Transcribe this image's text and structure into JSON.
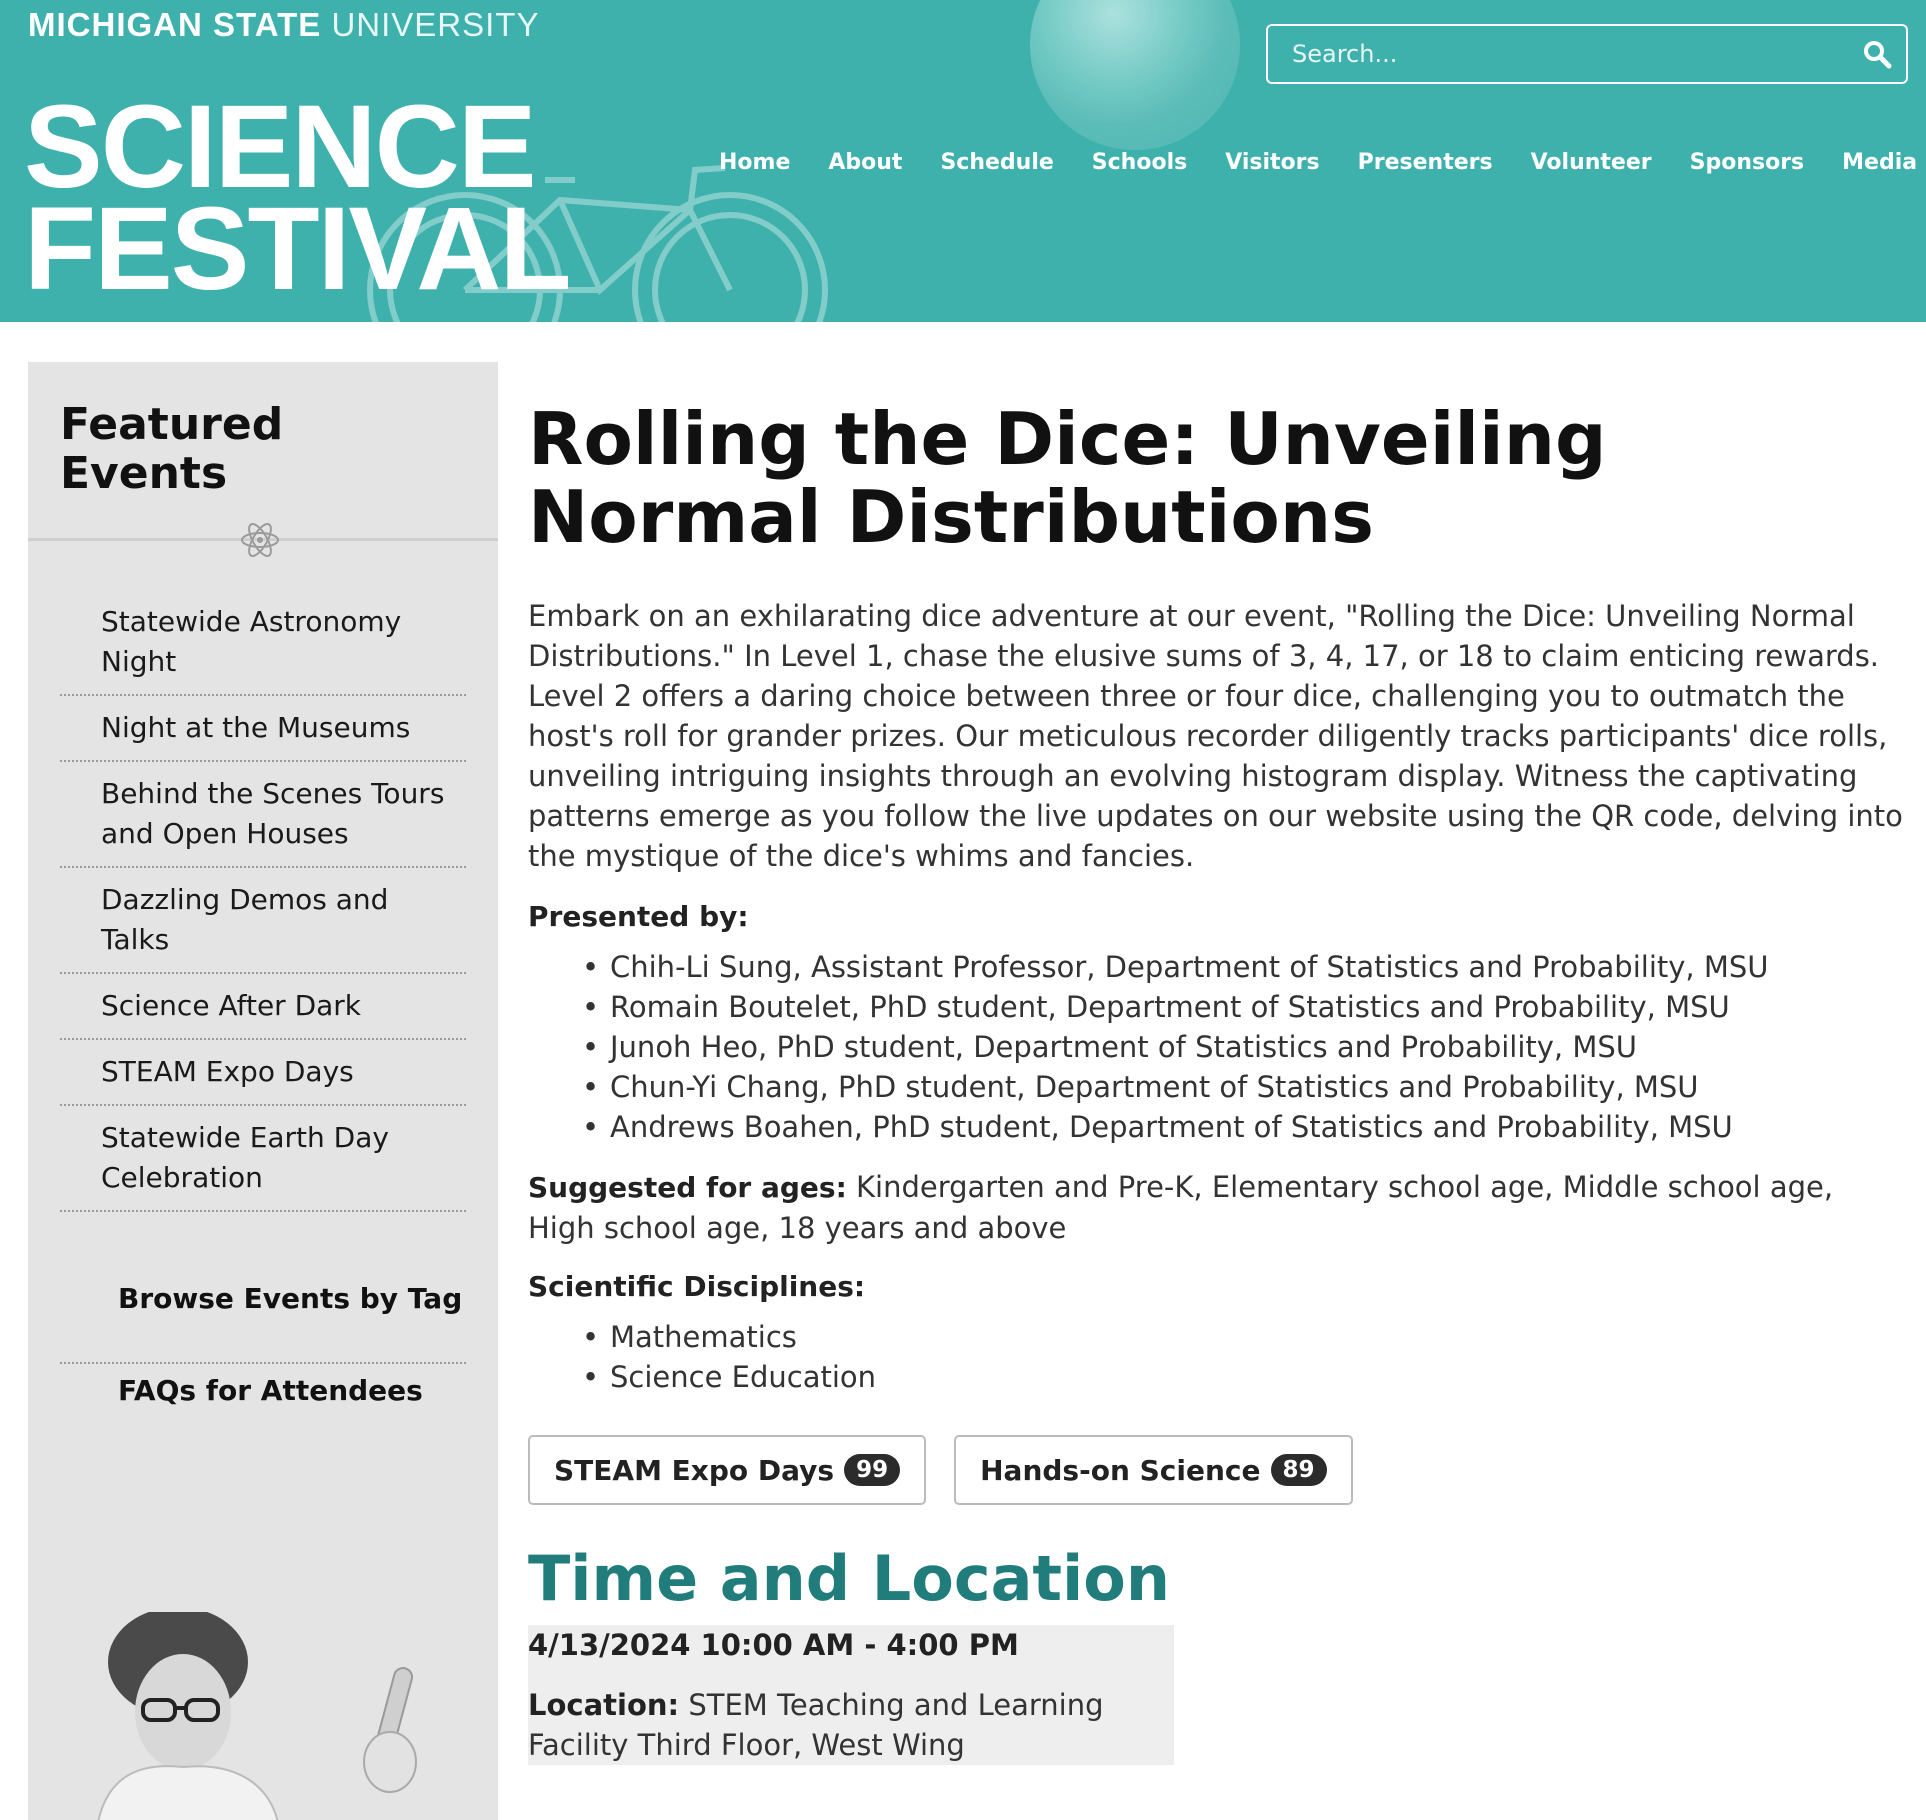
{
  "header": {
    "msu_bold": "MICHIGAN STATE",
    "msu_light": "UNIVERSITY",
    "logo_line1": "SCIENCE",
    "logo_line2": "FESTIVAL",
    "search_placeholder": "Search...",
    "accent_color": "#3fb1ad"
  },
  "nav": [
    "Home",
    "About",
    "Schedule",
    "Schools",
    "Visitors",
    "Presenters",
    "Volunteer",
    "Sponsors",
    "Media"
  ],
  "sidebar": {
    "title_line1": "Featured",
    "title_line2": "Events",
    "items": [
      "Statewide Astronomy Night",
      "Night at the Museums",
      "Behind the Scenes Tours and Open Houses",
      "Dazzling Demos and Talks",
      "Science After Dark",
      "STEAM Expo Days",
      "Statewide Earth Day Celebration"
    ],
    "browse": "Browse Events by Tag",
    "faq": "FAQs for Attendees"
  },
  "event": {
    "title": "Rolling the Dice: Unveiling Normal Distributions",
    "description": "Embark on an exhilarating dice adventure at our event, \"Rolling the Dice: Unveiling Normal Distributions.\" In Level 1, chase the elusive sums of 3, 4, 17, or 18 to claim enticing rewards. Level 2 offers a daring choice between three or four dice, challenging you to outmatch the host's roll for grander prizes. Our meticulous recorder diligently tracks participants' dice rolls, unveiling intriguing insights through an evolving histogram display. Witness the captivating patterns emerge as you follow the live updates on our website using the QR code, delving into the mystique of the dice's whims and fancies.",
    "presented_label": "Presented by:",
    "presenters": [
      "Chih-Li Sung, Assistant Professor, Department of Statistics and Probability, MSU",
      "Romain Boutelet, PhD student, Department of Statistics and Probability, MSU",
      "Junoh Heo, PhD student, Department of Statistics and Probability, MSU",
      "Chun-Yi Chang, PhD student, Department of Statistics and Probability, MSU",
      "Andrews Boahen, PhD student, Department of Statistics and Probability, MSU"
    ],
    "ages_label": "Suggested for ages:",
    "ages_value": " Kindergarten and Pre-K, Elementary school age, Middle school age, High school age, 18 years and above",
    "disciplines_label": "Scientific Disciplines:",
    "disciplines": [
      "Mathematics",
      "Science Education"
    ],
    "tags": [
      {
        "label": "STEAM Expo Days",
        "count": "99"
      },
      {
        "label": "Hands-on Science",
        "count": "89"
      }
    ],
    "time_location_heading": "Time and Location",
    "datetime": "4/13/2024 10:00 AM - 4:00 PM",
    "location_label": "Location:",
    "location_value": " STEM Teaching and Learning Facility Third Floor, West Wing",
    "heading_color": "#217d7b"
  }
}
